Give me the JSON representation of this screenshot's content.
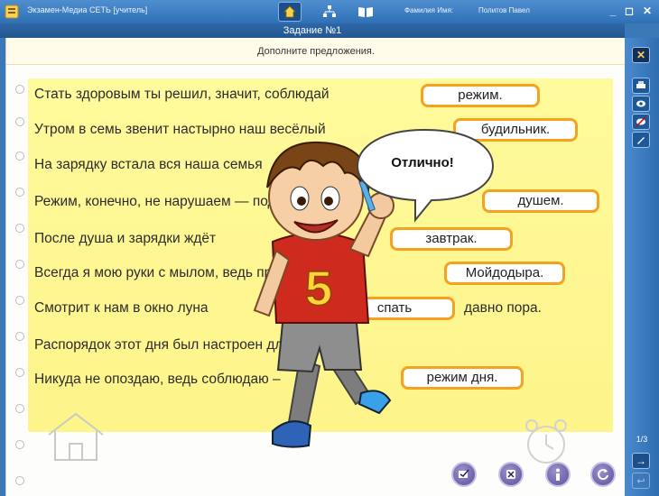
{
  "window": {
    "title": "Экзамен-Медиа СЕТЬ [учитель]",
    "user_label": "Фамилия Имя:",
    "user_name": "Политов Павел"
  },
  "task": {
    "title": "Задание №1",
    "instruction": "Дополните предложения."
  },
  "sentences": [
    {
      "text": "Стать здоровым ты решил, значит, соблюдай",
      "answer": "режим."
    },
    {
      "text": "Утром в семь звенит настырно наш весёлый",
      "answer": "будильник."
    },
    {
      "text": "На зарядку встала вся наша семья",
      "answer": ""
    },
    {
      "text": "Режим, конечно, не нарушаем — под холодным",
      "answer": "душем."
    },
    {
      "text": "После душа и зарядки ждёт",
      "answer": "завтрак."
    },
    {
      "text": "Всегда я мою руки с мылом, ведь пришёл к нам",
      "answer": "Мойдодыра."
    },
    {
      "text": "Смотрит к нам в окно луна",
      "answer": "спать",
      "suffix": "давно пора."
    },
    {
      "text": "Распорядок этот дня был настроен для меня.",
      "answer": ""
    },
    {
      "text": "Никуда не опоздаю, ведь соблюдаю –",
      "answer": "режим дня."
    }
  ],
  "bubble": {
    "text": "Отлично!"
  },
  "character": {
    "shirt_number": "5"
  },
  "pagination": {
    "label": "1/3"
  },
  "colors": {
    "accent": "#f5a21f",
    "panel": "#fdf48a",
    "titlebar": "#2f6fb5"
  }
}
